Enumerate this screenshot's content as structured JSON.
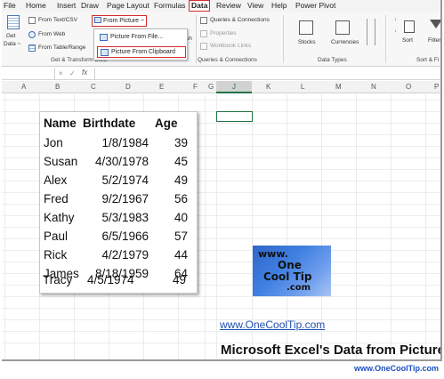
{
  "menu": {
    "file": "File",
    "home": "Home",
    "insert": "Insert",
    "draw": "Draw",
    "page_layout": "Page Layout",
    "formulas": "Formulas",
    "data": "Data",
    "review": "Review",
    "view": "View",
    "help": "Help",
    "power_pivot": "Power Pivot"
  },
  "ribbon": {
    "get_data": "Get",
    "get_data_2": "Data ~",
    "from_text_csv": "From Text/CSV",
    "from_web": "From Web",
    "from_table_range": "From Table/Range",
    "from_picture": "From Picture ~",
    "refresh_frag": "sh",
    "queries_connections": "Queries & Connections",
    "properties": "Properties",
    "workbook_links": "Workbook Links",
    "stocks": "Stocks",
    "currencies": "Currencies",
    "sort": "Sort",
    "filter": "Filter",
    "group_get_transform": "Get & Transform Data",
    "group_queries": "Queries & Connections",
    "group_data_types": "Data Types",
    "group_sort_filter": "Sort & Fi"
  },
  "dropdown": {
    "picture_from_file": "Picture From File...",
    "picture_from_clipboard": "Picture From Clipboard"
  },
  "formula_bar": {
    "fx": "fx",
    "x": "×",
    "check": "✓"
  },
  "columns": [
    "A",
    "B",
    "C",
    "D",
    "E",
    "F",
    "G",
    "J",
    "K",
    "L",
    "M",
    "N",
    "O",
    "P"
  ],
  "table": {
    "headers": [
      "Name",
      "Birthdate",
      "Age"
    ],
    "rows": [
      {
        "name": "Jon",
        "birthdate": "1/8/1984",
        "age": "39"
      },
      {
        "name": "Susan",
        "birthdate": "4/30/1978",
        "age": "45"
      },
      {
        "name": "Alex",
        "birthdate": "5/2/1974",
        "age": "49"
      },
      {
        "name": "Fred",
        "birthdate": "9/2/1967",
        "age": "56"
      },
      {
        "name": "Kathy",
        "birthdate": "5/3/1983",
        "age": "40"
      },
      {
        "name": "Paul",
        "birthdate": "6/5/1966",
        "age": "57"
      },
      {
        "name": "Rick",
        "birthdate": "4/2/1979",
        "age": "44"
      },
      {
        "name": "James",
        "birthdate": "8/18/1959",
        "age": "64"
      },
      {
        "name": "Tracy",
        "birthdate": "4/5/1974",
        "age": "49"
      }
    ]
  },
  "logo": {
    "line1": "www.",
    "line2": "One",
    "line3": "Cool Tip",
    "line4": ".com"
  },
  "site_link": "www.OneCoolTip.com",
  "caption": "Microsoft Excel's Data from Picture",
  "footer_link": "www.OneCoolTip.com",
  "colors": {
    "highlight_red": "#d62b2b",
    "excel_green": "#217346",
    "link_blue": "#1f4fb0"
  }
}
